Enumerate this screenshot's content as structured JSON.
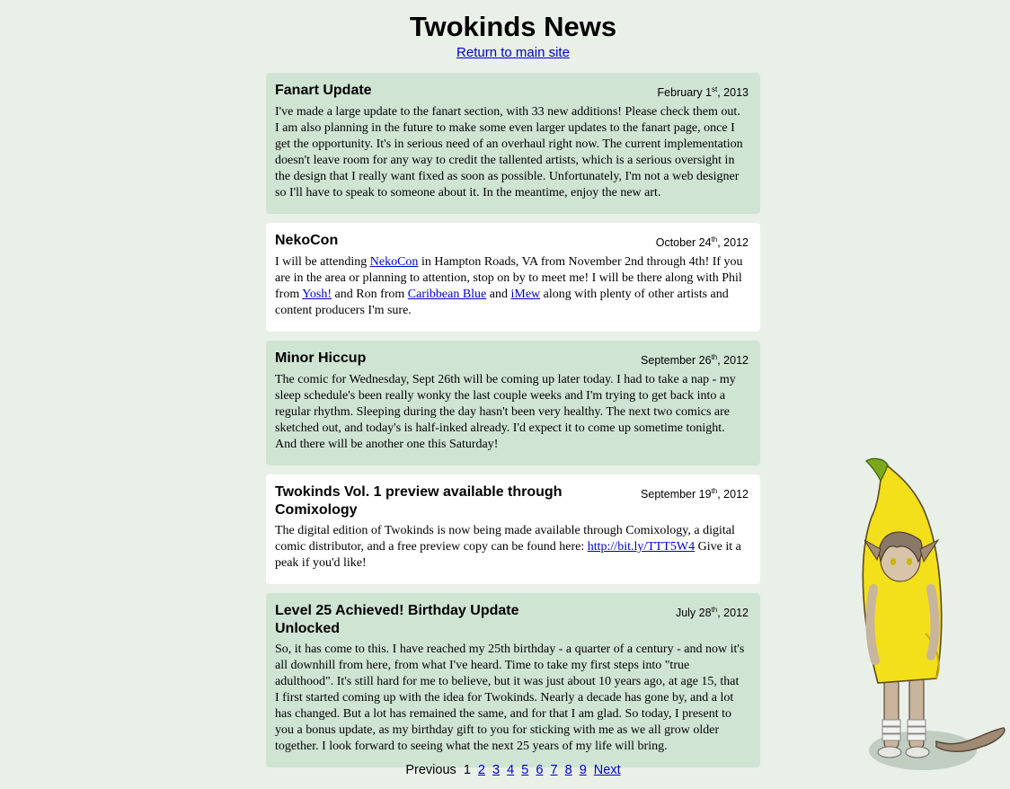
{
  "header": {
    "title": "Twokinds News",
    "return_link": "Return to main site"
  },
  "posts": [
    {
      "title": "Fanart Update",
      "date_month_day": "February 1",
      "date_suffix": "st",
      "date_year": ", 2013",
      "body": "I've made a large update to the fanart section, with 33 new additions! Please check them out. I am also planning in the future to make some even larger updates to the fanart page, once I get the opportunity. It's in serious need of an overhaul right now. The current implementation doesn't leave room for any way to credit the tallented artists, which is a serious oversight in the design that I really want fixed as soon as possible. Unfortunately, I'm not a web designer so I'll have to speak to someone about it. In the meantime, enjoy the new art."
    },
    {
      "title": "NekoCon",
      "date_month_day": "October 24",
      "date_suffix": "th",
      "date_year": ", 2012",
      "body_parts": [
        "I will be attending ",
        "NekoCon",
        " in Hampton Roads, VA from November 2nd through 4th! If you are in the area or planning to attention, stop on by to meet me! I will be there along with Phil from ",
        "Yosh!",
        " and Ron from ",
        "Caribbean Blue",
        " and ",
        "iMew",
        " along with plenty of other artists and content producers I'm sure."
      ]
    },
    {
      "title": "Minor Hiccup",
      "date_month_day": "September 26",
      "date_suffix": "th",
      "date_year": ", 2012",
      "body": "The comic for Wednesday, Sept 26th will be coming up later today. I had to take a nap - my sleep schedule's been really wonky the last couple weeks and I'm trying to get back into a regular rhythm. Sleeping during the day hasn't been very healthy. The next two comics are sketched out, and today's is half-inked already. I'd expect it to come up sometime tonight. And there will be another one this Saturday!"
    },
    {
      "title": "Twokinds Vol. 1 preview available through Comixology",
      "date_month_day": "September 19",
      "date_suffix": "th",
      "date_year": ", 2012",
      "body_parts": [
        "The digital edition of Twokinds is now being made available through Comixology, a digital comic distributor, and a free preview copy can be found here: ",
        "http://bit.ly/TTT5W4",
        " Give it a peak if you'd like!"
      ]
    },
    {
      "title": "Level 25 Achieved! Birthday Update Unlocked",
      "date_month_day": "July 28",
      "date_suffix": "th",
      "date_year": ", 2012",
      "body": "So, it has come to this. I have reached my 25th birthday - a quarter of a century - and now it's all downhill from here, from what I've heard. Time to take my first steps into \"true adulthood\". It's still hard for me to believe, but it was just about 10 years ago, at age 15, that I first started coming up with the idea for Twokinds. Nearly a decade has gone by, and a lot has changed. But a lot has remained the same, and for that I am glad. So today, I present to you a bonus update, as my birthday gift to you for sticking with me as we all grow older together. I look forward to seeing what the next 25 years of my life will bring."
    }
  ],
  "pager": {
    "previous": "Previous",
    "current": "1",
    "pages": [
      "2",
      "3",
      "4",
      "5",
      "6",
      "7",
      "8",
      "9"
    ],
    "next": "Next"
  },
  "colors": {
    "background": "#e8f0e8",
    "post_green": "#d0e4d4",
    "post_white": "#ffffff",
    "link": "#0000cc"
  }
}
